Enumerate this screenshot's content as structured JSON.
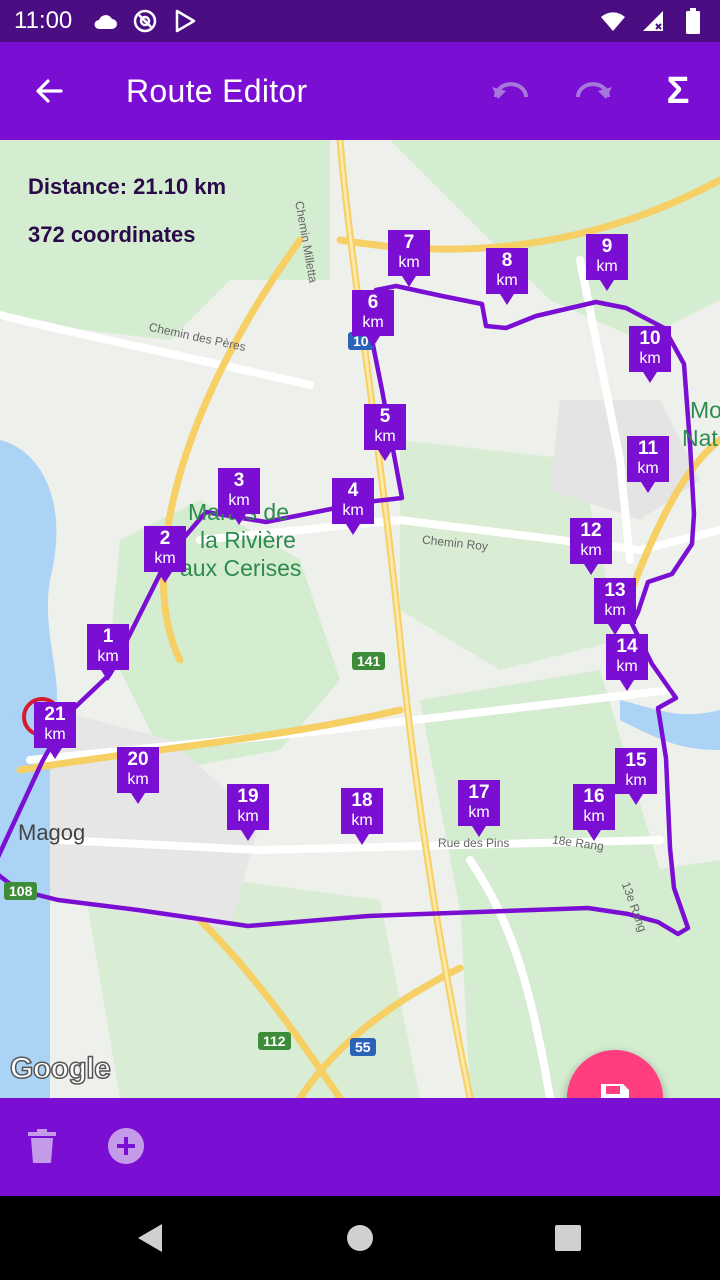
{
  "status_bar": {
    "time": "11:00",
    "left_icons": [
      "cloud-icon",
      "at-sign-icon",
      "play-store-icon"
    ],
    "right_icons": [
      "wifi-icon",
      "signal-icon",
      "battery-icon"
    ]
  },
  "app_bar": {
    "title": "Route Editor",
    "actions": [
      "undo-icon",
      "redo-icon",
      "sigma-icon"
    ],
    "sigma_glyph": "Σ"
  },
  "map": {
    "distance_text": "Distance: 21.10 km",
    "coordinates_text": "372 coordinates",
    "km_unit": "km",
    "markers": [
      "1",
      "2",
      "3",
      "4",
      "5",
      "6",
      "7",
      "8",
      "9",
      "10",
      "11",
      "12",
      "13",
      "14",
      "15",
      "16",
      "17",
      "18",
      "19",
      "20",
      "21"
    ],
    "place_names": {
      "marais_line1": "Marais de",
      "marais_line2": "la Rivière",
      "marais_line3": "aux Cerises",
      "mont_partial_1": "Mo",
      "mont_partial_2": "Nat",
      "town": "Magog"
    },
    "road_labels": {
      "chemin_milletta": "Chemin Milletta",
      "chemin_des_peres": "Chemin des Pères",
      "chemin_roy": "Chemin Roy",
      "rue_des_pins": "Rue des Pins",
      "rang_18e": "18e Rang",
      "rang_13e": "13e Rang"
    },
    "route_shields": [
      "141",
      "108",
      "112",
      "55",
      "10"
    ],
    "attribution": "Google",
    "colors": {
      "route": "#7a0ed2",
      "marker": "#7a0ed2",
      "water": "#aad3f5"
    }
  },
  "bottom_bar": {
    "actions": [
      "delete-icon",
      "add-circle-icon"
    ],
    "fab": "save-icon"
  },
  "nav_bar": {
    "buttons": [
      "back-triangle-icon",
      "home-circle-icon",
      "recents-square-icon"
    ]
  }
}
